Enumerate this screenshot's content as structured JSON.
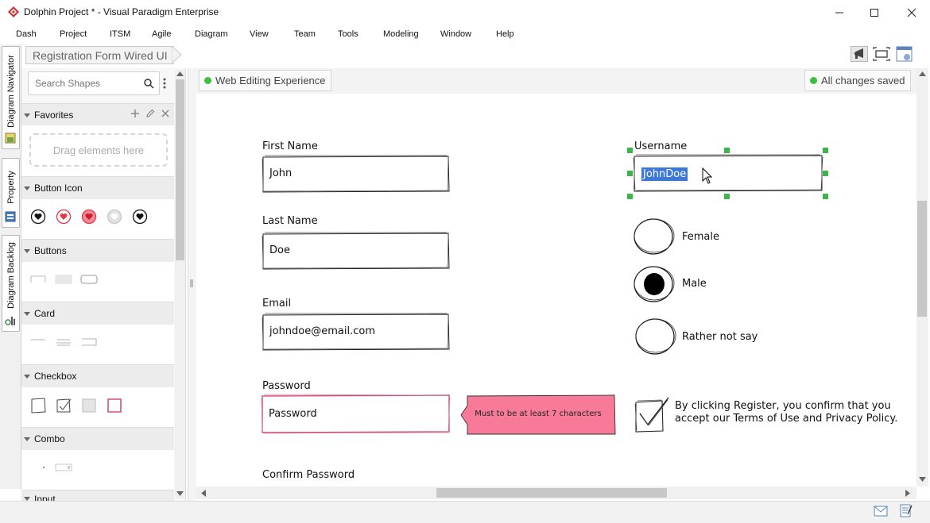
{
  "window": {
    "title": "Dolphin Project * - Visual Paradigm Enterprise",
    "minimize_icon": "minimize-icon",
    "maximize_icon": "maximize-icon",
    "close_icon": "close-icon"
  },
  "menu": [
    "Dash",
    "Project",
    "ITSM",
    "Agile",
    "Diagram",
    "View",
    "Team",
    "Tools",
    "Modeling",
    "Window",
    "Help"
  ],
  "breadcrumb": "Registration Form Wired UI",
  "side_tabs": [
    "Diagram Navigator",
    "Property",
    "Diagram Backlog"
  ],
  "shapes_panel": {
    "search_placeholder": "Search Shapes",
    "drag_hint": "Drag elements here",
    "categories": [
      "Favorites",
      "Button Icon",
      "Buttons",
      "Card",
      "Checkbox",
      "Combo",
      "Input"
    ]
  },
  "diagram": {
    "mode_label": "Web Editing Experience",
    "save_status": "All changes saved",
    "status_color": "#3fbf3f"
  },
  "form": {
    "first_name_label": "First Name",
    "first_name_value": "John",
    "last_name_label": "Last Name",
    "last_name_value": "Doe",
    "email_label": "Email",
    "email_value": "johndoe@email.com",
    "password_label": "Password",
    "password_value": "Password",
    "password_hint": "Must to be at least 7 characters",
    "confirm_password_label": "Confirm Password",
    "username_label": "Username",
    "username_value": "JohnDoe",
    "gender_options": [
      "Female",
      "Male",
      "Rather not say"
    ],
    "gender_selected": "Male",
    "terms_line1": "By clicking Register, you confirm that you",
    "terms_line2": "accept our Terms of Use and Privacy Policy.",
    "terms_checked": true,
    "hint_color": "#f77b98",
    "error_border_color": "#d0507a",
    "selection_handle_color": "#3cb54a"
  }
}
